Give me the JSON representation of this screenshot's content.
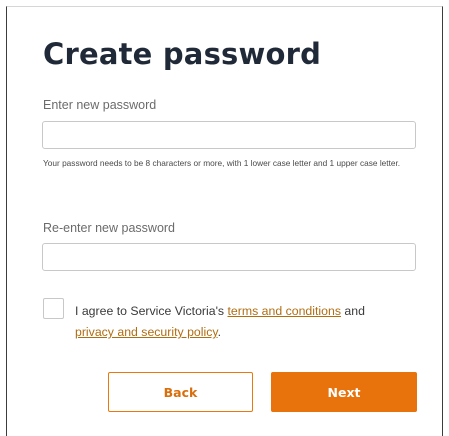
{
  "form": {
    "title": "Create password",
    "new_password": {
      "label": "Enter new password",
      "value": "",
      "placeholder": ""
    },
    "hint": "Your password needs to be 8 characters or more, with 1 lower case letter and 1 upper case letter.",
    "confirm_password": {
      "label": "Re-enter new password",
      "value": "",
      "placeholder": ""
    },
    "agreement": {
      "checked": false,
      "prefix": "I agree to Service Victoria's ",
      "terms_link": "terms and conditions",
      "middle": " and ",
      "privacy_link": "privacy and security policy",
      "suffix": "."
    },
    "buttons": {
      "back_label": "Back",
      "next_label": "Next"
    }
  },
  "colors": {
    "accent": "#e8720c",
    "link": "#b06d12",
    "title": "#1f2937"
  }
}
